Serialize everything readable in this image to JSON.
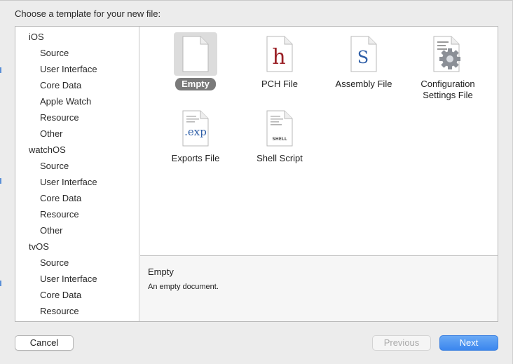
{
  "dialog": {
    "prompt": "Choose a template for your new file:"
  },
  "sidebar": {
    "groups": [
      {
        "name": "iOS",
        "items": [
          "Source",
          "User Interface",
          "Core Data",
          "Apple Watch",
          "Resource",
          "Other"
        ]
      },
      {
        "name": "watchOS",
        "items": [
          "Source",
          "User Interface",
          "Core Data",
          "Resource",
          "Other"
        ]
      },
      {
        "name": "tvOS",
        "items": [
          "Source",
          "User Interface",
          "Core Data",
          "Resource"
        ]
      }
    ]
  },
  "templates": [
    {
      "label": "Empty",
      "icon": "empty-document-icon",
      "selected": true
    },
    {
      "label": "PCH File",
      "icon": "header-file-icon",
      "glyph": "h",
      "selected": false
    },
    {
      "label": "Assembly File",
      "icon": "assembly-file-icon",
      "glyph": "S",
      "selected": false
    },
    {
      "label": "Configuration Settings File",
      "label_line1": "Configuration",
      "label_line2": "Settings File",
      "icon": "config-settings-icon",
      "selected": false
    },
    {
      "label": "Exports File",
      "icon": "exports-file-icon",
      "glyph": ".exp",
      "selected": false
    },
    {
      "label": "Shell Script",
      "icon": "shell-script-icon",
      "glyph": "SHELL",
      "selected": false
    }
  ],
  "description": {
    "title": "Empty",
    "text": "An empty document."
  },
  "buttons": {
    "cancel": "Cancel",
    "previous": "Previous",
    "next": "Next"
  },
  "colors": {
    "accent": "#3b86ee",
    "selection": "#7a7a7a",
    "glyph_red": "#9a1f25",
    "glyph_blue": "#2f5fa8"
  }
}
